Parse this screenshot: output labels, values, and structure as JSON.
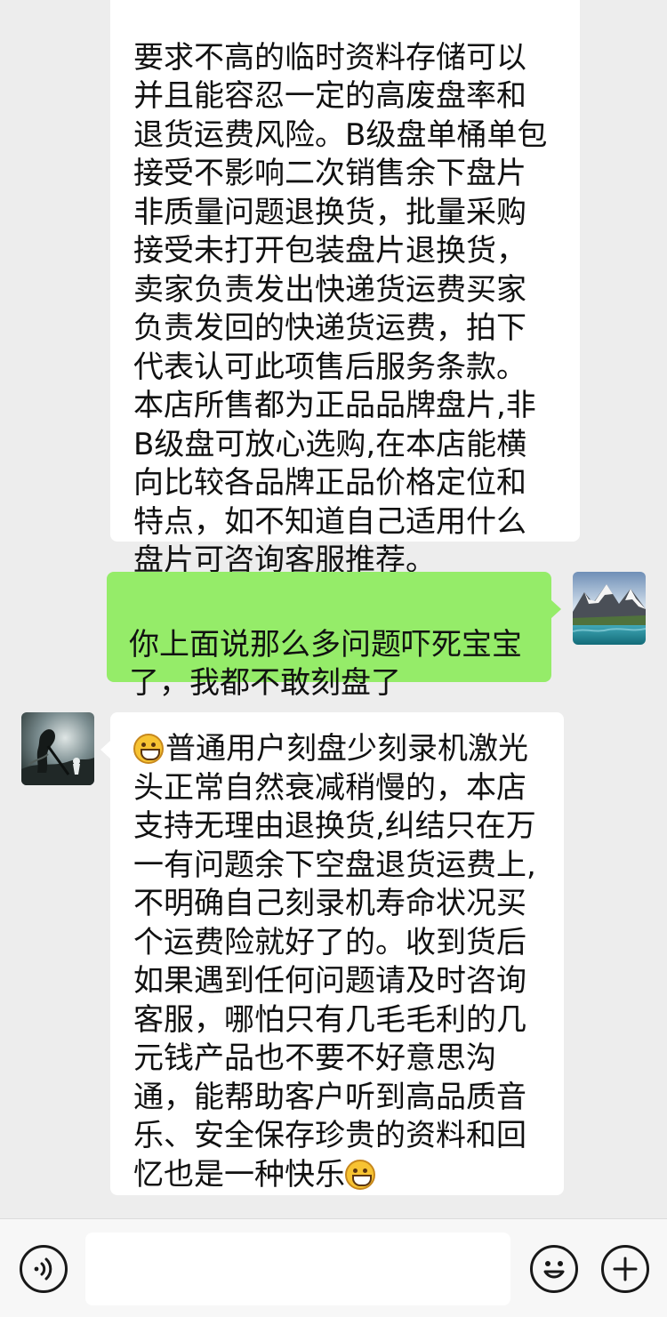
{
  "messages": [
    {
      "id": "merchant_terms",
      "side": "left",
      "text": "要求不高的临时资料存储可以\n并且能容忍一定的高废盘率和\n退货运费风险。B级盘单桶单包\n接受不影响二次销售余下盘片\n非质量问题退换货，批量采购\n接受未打开包装盘片退换货，\n卖家负责发出快递货运费买家\n负责发回的快递货运费，拍下\n代表认可此项售后服务条款。\n本店所售都为正品品牌盘片,非\nB级盘可放心选购,在本店能横\n向比较各品牌正品价格定位和\n特点，如不知道自己适用什么\n盘片可咨询客服推荐。"
    },
    {
      "id": "buyer_reply",
      "side": "right",
      "text": "你上面说那么多问题吓死宝宝\n了，我都不敢刻盘了"
    },
    {
      "id": "merchant_reply",
      "side": "left",
      "leading_emoji": "grinning-face",
      "text": "普通用户刻盘少刻录机激光\n头正常自然衰减稍慢的，本店\n支持无理由退换货,纠结只在万\n一有问题余下空盘退货运费上,\n不明确自己刻录机寿命状况买\n个运费险就好了的。收到货后\n如果遇到任何问题请及时咨询\n客服，哪怕只有几毛毛利的几\n元钱产品也不要不好意思沟\n通，能帮助客户听到高品质音\n乐、安全保存珍贵的资料和回\n忆也是一种快乐",
      "trailing_emoji": "grinning-face"
    }
  ],
  "input_bar": {
    "message_value": "",
    "left_icon": "voice-icon",
    "right_icons": [
      "emoji-icon",
      "plus-icon"
    ]
  },
  "colors": {
    "chat_background": "#ededed",
    "incoming_bubble": "#ffffff",
    "outgoing_bubble": "#95ec69",
    "text": "#111111"
  }
}
